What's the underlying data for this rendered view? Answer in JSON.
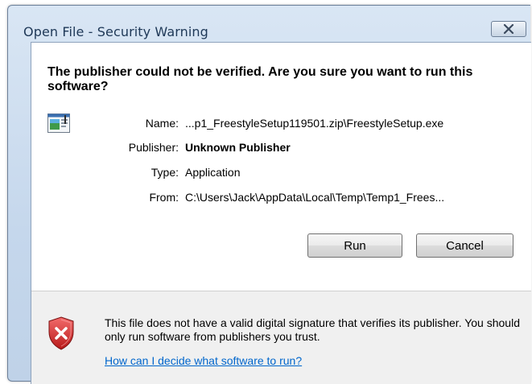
{
  "window": {
    "title": "Open File - Security Warning",
    "close_label": "Close"
  },
  "dialog": {
    "headline": "The publisher could not be verified.  Are you sure you want to run this software?",
    "fields": [
      {
        "label": "Name:",
        "value": "...p1_FreestyleSetup119501.zip\\FreestyleSetup.exe",
        "bold": false
      },
      {
        "label": "Publisher:",
        "value": "Unknown Publisher",
        "bold": true
      },
      {
        "label": "Type:",
        "value": "Application",
        "bold": false
      },
      {
        "label": "From:",
        "value": "C:\\Users\\Jack\\AppData\\Local\\Temp\\Temp1_Frees...",
        "bold": false
      }
    ],
    "buttons": {
      "run": "Run",
      "cancel": "Cancel"
    }
  },
  "warning": {
    "text": "This file does not have a valid digital signature that verifies its publisher.  You should only run software from publishers you trust.",
    "link": "How can I decide what software to run?",
    "icon": "shield-error-icon"
  },
  "colors": {
    "title_text": "#1e3857",
    "link": "#0066cc",
    "shield_red": "#d22a2a",
    "footer_bg": "#f0f0f0"
  }
}
